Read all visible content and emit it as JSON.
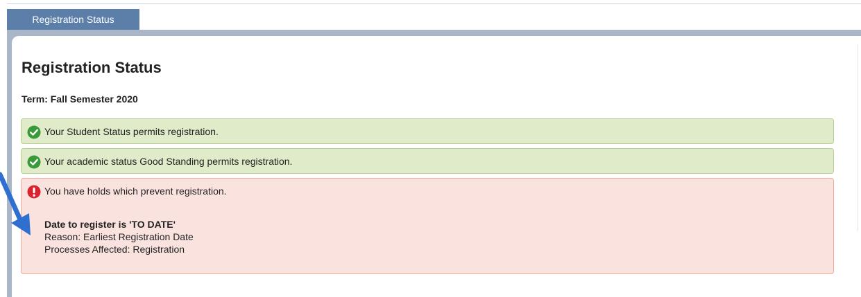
{
  "tabs": [
    {
      "label": "Registration Status"
    }
  ],
  "page": {
    "title": "Registration Status",
    "term": "Term: Fall Semester 2020"
  },
  "messages": [
    {
      "type": "success",
      "icon": "check-circle-icon",
      "text": "Your Student Status permits registration."
    },
    {
      "type": "success",
      "icon": "check-circle-icon",
      "text": "Your academic status Good Standing permits registration."
    },
    {
      "type": "error",
      "icon": "exclamation-circle-icon",
      "text": "You have holds which prevent registration.",
      "detail_title": "Date to register is 'TO DATE'",
      "reason": "Reason: Earliest Registration Date",
      "processes": "Processes Affected: Registration"
    }
  ],
  "colors": {
    "tab_bg": "#5b7fa8",
    "success_bg": "#dfebc9",
    "success_border": "#b7cf91",
    "success_icon": "#3a9a3a",
    "error_bg": "#fae3df",
    "error_border": "#f0aaa0",
    "error_icon": "#d9232d",
    "annotation_arrow": "#2f6fd0"
  }
}
